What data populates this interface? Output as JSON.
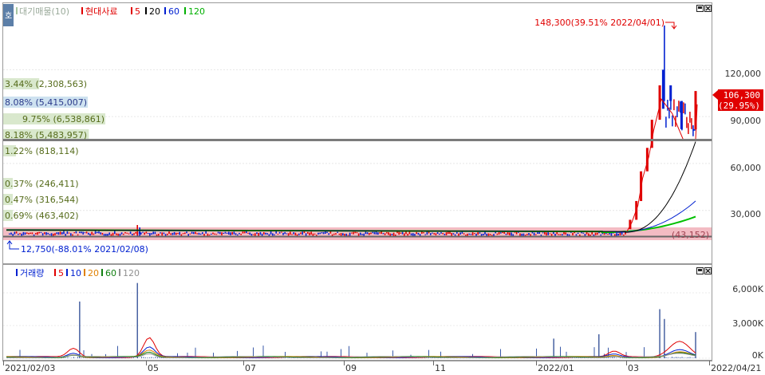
{
  "price_panel": {
    "legend": {
      "marker": "호",
      "volume_profile_label": "대기매물(10)",
      "stock_name": "현대사료",
      "ma_labels": [
        "5",
        "20",
        "60",
        "120"
      ]
    },
    "y_ticks": [
      "120,000",
      "90,000",
      "60,000",
      "30,000"
    ],
    "max_annotation": "148,300(39.51% 2022/04/01)",
    "min_annotation": "12,750(-88.01% 2021/02/08)",
    "current_price": "106,300",
    "current_change": "(29.95%)",
    "hidden_label": "(43,152)",
    "profile_labels": [
      "3.44% (2,308,563)",
      "8.08% (5,415,007)",
      "9.75% (6,538,861)",
      "8.18% (5,483,957)",
      "1.22% (818,114)",
      "0.37% (246,411)",
      "0.47% (316,544)",
      "0.69% (463,402)"
    ]
  },
  "volume_panel": {
    "legend": {
      "label": "거래량",
      "ma_labels": [
        "5",
        "10",
        "20",
        "60",
        "120"
      ]
    },
    "y_ticks": [
      "6,000K",
      "3,000K",
      "0K"
    ]
  },
  "x_axis": {
    "labels": [
      "2021/02/03",
      "05",
      "07",
      "09",
      "11",
      "2022/01",
      "03",
      "2022/04/21"
    ]
  },
  "colors": {
    "up": "#e00000",
    "down": "#0020d0",
    "ma5": "#e00000",
    "ma20": "#000000",
    "ma60": "#0020d0",
    "ma120": "#00c000",
    "vol_ma20": "#e08000",
    "vol_ma60": "#108010",
    "vol_ma120": "#909090"
  },
  "chart_data": [
    {
      "type": "candlestick",
      "title": "현대사료",
      "y_ticks": [
        30000,
        60000,
        90000,
        120000
      ],
      "ylim": [
        0,
        155000
      ],
      "x_range": [
        "2021/02/03",
        "2022/04/21"
      ],
      "series": [
        {
          "name": "현대사료",
          "points": [
            {
              "date": "2021/02/08",
              "low": 12750
            },
            {
              "date": "2021/04/28",
              "close": 20000
            },
            {
              "date": "2021/06/15",
              "close": 18500
            },
            {
              "date": "2021/09/01",
              "close": 17500
            },
            {
              "date": "2021/11/15",
              "close": 15500
            },
            {
              "date": "2022/01/10",
              "close": 15000
            },
            {
              "date": "2022/02/15",
              "close": 16500
            },
            {
              "date": "2022/03/07",
              "close": 18000
            },
            {
              "date": "2022/03/10",
              "close": 24000
            },
            {
              "date": "2022/03/14",
              "close": 36000
            },
            {
              "date": "2022/03/17",
              "close": 55000
            },
            {
              "date": "2022/03/21",
              "close": 70000
            },
            {
              "date": "2022/03/24",
              "close": 88000
            },
            {
              "date": "2022/03/29",
              "close": 110000
            },
            {
              "date": "2022/04/01",
              "high": 148300
            },
            {
              "date": "2022/04/05",
              "close": 100000
            },
            {
              "date": "2022/04/12",
              "close": 82000
            },
            {
              "date": "2022/04/20",
              "close": 81800
            },
            {
              "date": "2022/04/21",
              "close": 106300
            }
          ]
        },
        {
          "name": "5",
          "values": [
            {
              "date": "2022/04/21",
              "value": 84000
            }
          ]
        },
        {
          "name": "20",
          "values": [
            {
              "date": "2022/04/21",
              "value": 74000
            }
          ]
        },
        {
          "name": "60",
          "values": [
            {
              "date": "2022/04/21",
              "value": 36000
            }
          ]
        },
        {
          "name": "120",
          "values": [
            {
              "date": "2022/04/21",
              "value": 26000
            }
          ]
        }
      ],
      "volume_profile": [
        {
          "pct": 3.44,
          "volume": 2308563
        },
        {
          "pct": 8.08,
          "volume": 5415007
        },
        {
          "pct": 9.75,
          "volume": 6538861
        },
        {
          "pct": 8.18,
          "volume": 5483957
        },
        {
          "pct": 1.22,
          "volume": 818114
        },
        {
          "pct": 0.37,
          "volume": 246411
        },
        {
          "pct": 0.47,
          "volume": 316544
        },
        {
          "pct": 0.69,
          "volume": 463402
        }
      ]
    },
    {
      "type": "bar",
      "title": "거래량",
      "y_ticks_k": [
        0,
        3000,
        6000
      ],
      "ylim_k": [
        0,
        7500
      ],
      "series": [
        {
          "name": "거래량",
          "points": [
            {
              "date": "2021/03/22",
              "value_k": 5200
            },
            {
              "date": "2021/04/28",
              "value_k": 6900
            },
            {
              "date": "2022/01/20",
              "value_k": 1800
            },
            {
              "date": "2022/02/18",
              "value_k": 2200
            },
            {
              "date": "2022/03/29",
              "value_k": 4500
            },
            {
              "date": "2022/04/01",
              "value_k": 3600
            },
            {
              "date": "2022/04/21",
              "value_k": 2400
            }
          ]
        },
        {
          "name": "5",
          "values": []
        },
        {
          "name": "10",
          "values": []
        },
        {
          "name": "20",
          "values": []
        },
        {
          "name": "60",
          "values": []
        },
        {
          "name": "120",
          "values": []
        }
      ]
    }
  ]
}
